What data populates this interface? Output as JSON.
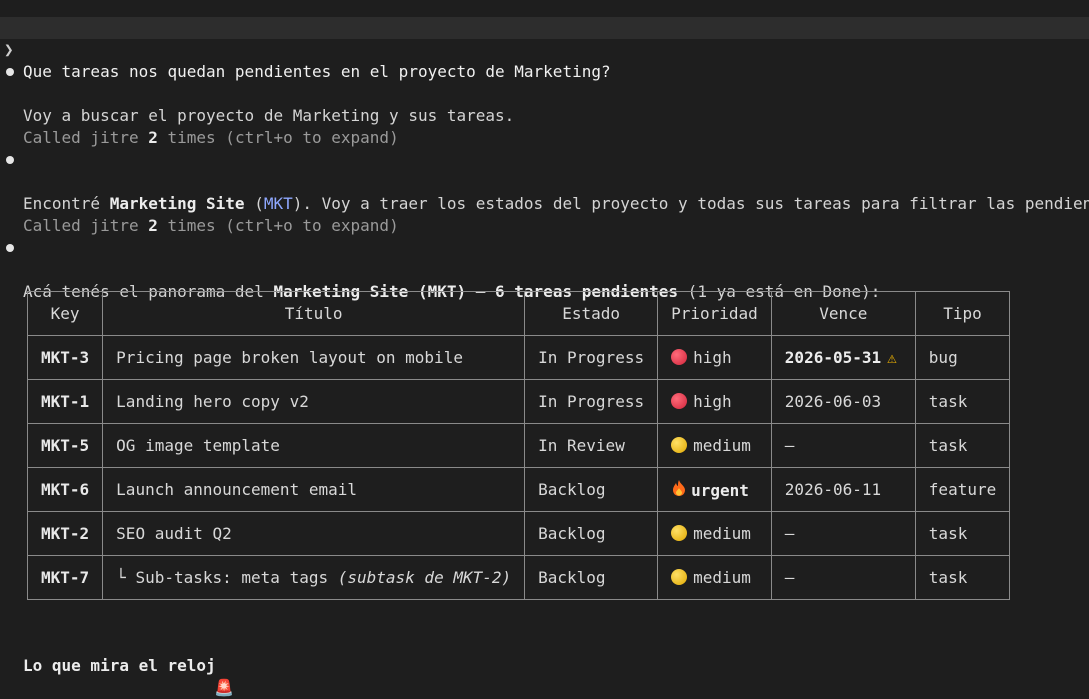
{
  "prompt": {
    "chevron": "❯",
    "text": "Que tareas nos quedan pendientes en el proyecto de Marketing?"
  },
  "messages": [
    {
      "text": "Voy a buscar el proyecto de Marketing y sus tareas."
    },
    {
      "call_prefix": "Called jitre ",
      "call_count": "2",
      "call_suffix": " times (ctrl+o to expand)"
    },
    {
      "part1": "Encontré ",
      "bold": "Marketing Site",
      "part2": " (",
      "link": "MKT",
      "part3": "). Voy a traer los estados del proyecto y todas sus tareas para filtrar las pendientes."
    },
    {
      "call_prefix": "Called jitre ",
      "call_count": "2",
      "call_suffix": " times (ctrl+o to expand)"
    },
    {
      "part1": "Acá tenés el panorama del ",
      "bold1": "Marketing Site (MKT)",
      "part2": " — ",
      "bold2": "6 tareas pendientes",
      "part3": " (1 ya está en Done):"
    }
  ],
  "table": {
    "headers": [
      "Key",
      "Título",
      "Estado",
      "Prioridad",
      "Vence",
      "Tipo"
    ],
    "rows": [
      {
        "key": "MKT-3",
        "title": "Pricing page broken layout on mobile",
        "status": "In Progress",
        "priority": "high",
        "priority_icon": "red-circle",
        "due": "2026-05-31",
        "due_warn": "⚠",
        "type": "bug"
      },
      {
        "key": "MKT-1",
        "title": "Landing hero copy v2",
        "status": "In Progress",
        "priority": "high",
        "priority_icon": "red-circle",
        "due": "2026-06-03",
        "type": "task"
      },
      {
        "key": "MKT-5",
        "title": "OG image template",
        "status": "In Review",
        "priority": "medium",
        "priority_icon": "yellow-circle",
        "due": "—",
        "type": "task"
      },
      {
        "key": "MKT-6",
        "title": "Launch announcement email",
        "status": "Backlog",
        "priority": "urgent",
        "priority_icon": "fire",
        "due": "2026-06-11",
        "type": "feature"
      },
      {
        "key": "MKT-2",
        "title": "SEO audit Q2",
        "status": "Backlog",
        "priority": "medium",
        "priority_icon": "yellow-circle",
        "due": "—",
        "type": "task"
      },
      {
        "key": "MKT-7",
        "title_prefix": "└ Sub-tasks: meta tags ",
        "title_italic": "(subtask de MKT-2)",
        "status": "Backlog",
        "priority": "medium",
        "priority_icon": "yellow-circle",
        "due": "—",
        "type": "task"
      }
    ]
  },
  "footer": {
    "heading": "Lo que mira el reloj",
    "icon": "🚨"
  }
}
